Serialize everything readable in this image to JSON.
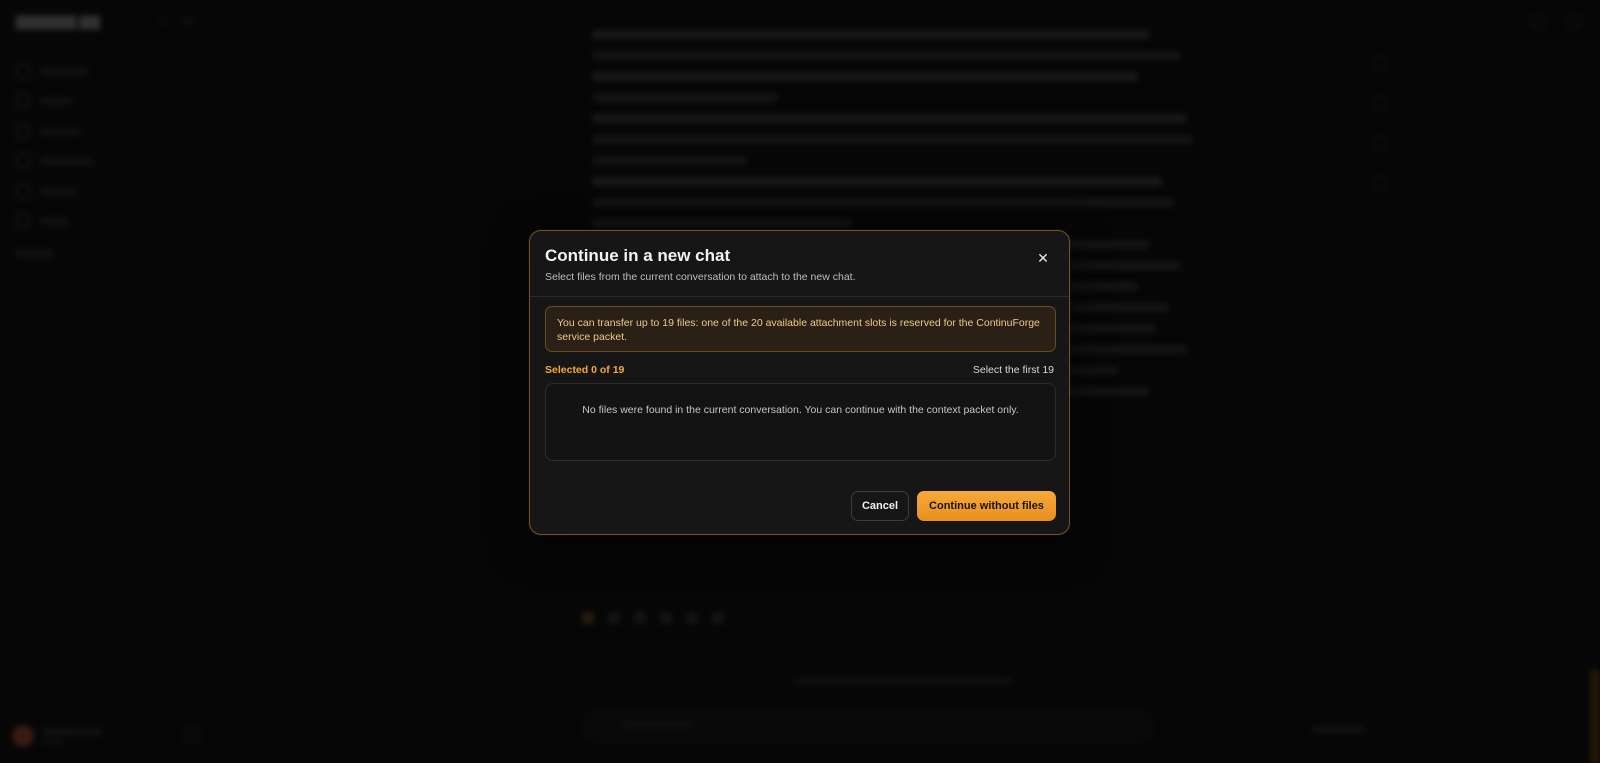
{
  "modal": {
    "title": "Continue in a new chat",
    "subtitle": "Select files from the current conversation to attach to the new chat.",
    "close_icon_glyph": "✕",
    "notice": "You can transfer up to 19 files: one of the 20 available attachment slots is reserved for the ContinuForge service packet.",
    "selected_count": "Selected 0 of 19",
    "select_first_label": "Select the first 19",
    "empty_message": "No files were found in the current conversation. You can continue with the context packet only.",
    "cancel_label": "Cancel",
    "continue_label": "Continue without files"
  },
  "colors": {
    "accent": "#f5a83b",
    "notice_text": "#f0c98a",
    "modal_border": "#6e5426",
    "background": "#0b0b0b"
  }
}
